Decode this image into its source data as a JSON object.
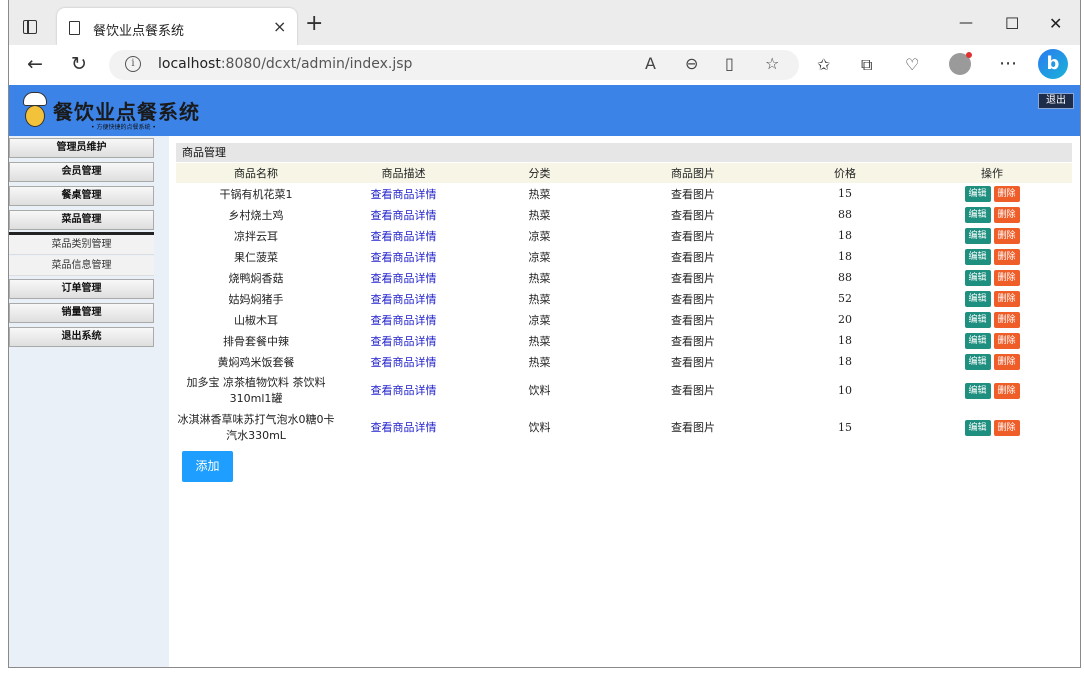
{
  "browser": {
    "tab_title": "餐饮业点餐系统",
    "tab_close": "×",
    "new_tab": "+",
    "minimize": "—",
    "maximize": "☐",
    "close": "✕",
    "url_host": "localhost",
    "url_rest": ":8080/dcxt/admin/index.jsp",
    "info": "i"
  },
  "app": {
    "title": "餐饮业点餐系统",
    "subtitle": "• 方便快捷的点餐系统 •",
    "logout_top": "退出"
  },
  "sidebar": {
    "items": [
      {
        "label": "管理员维护"
      },
      {
        "label": "会员管理"
      },
      {
        "label": "餐桌管理"
      },
      {
        "label": "菜品管理"
      }
    ],
    "subitems": [
      {
        "label": "菜品类别管理"
      },
      {
        "label": "菜品信息管理"
      }
    ],
    "items2": [
      {
        "label": "订单管理"
      },
      {
        "label": "销量管理"
      },
      {
        "label": "退出系统"
      }
    ]
  },
  "main": {
    "section_title": "商品管理",
    "columns": [
      "商品名称",
      "商品描述",
      "分类",
      "商品图片",
      "价格",
      "操作"
    ],
    "rows": [
      {
        "name": "干锅有机花菜1",
        "desc": "查看商品详情",
        "category": "热菜",
        "image": "查看图片",
        "price": "15"
      },
      {
        "name": "乡村烧土鸡",
        "desc": "查看商品详情",
        "category": "热菜",
        "image": "查看图片",
        "price": "88"
      },
      {
        "name": "凉拌云耳",
        "desc": "查看商品详情",
        "category": "凉菜",
        "image": "查看图片",
        "price": "18"
      },
      {
        "name": "果仁菠菜",
        "desc": "查看商品详情",
        "category": "凉菜",
        "image": "查看图片",
        "price": "18"
      },
      {
        "name": "烧鸭焖香菇",
        "desc": "查看商品详情",
        "category": "热菜",
        "image": "查看图片",
        "price": "88"
      },
      {
        "name": "姑妈焖猪手",
        "desc": "查看商品详情",
        "category": "热菜",
        "image": "查看图片",
        "price": "52"
      },
      {
        "name": "山椒木耳",
        "desc": "查看商品详情",
        "category": "凉菜",
        "image": "查看图片",
        "price": "20"
      },
      {
        "name": "排骨套餐中辣",
        "desc": "查看商品详情",
        "category": "热菜",
        "image": "查看图片",
        "price": "18"
      },
      {
        "name": "黄焖鸡米饭套餐",
        "desc": "查看商品详情",
        "category": "热菜",
        "image": "查看图片",
        "price": "18"
      },
      {
        "name": "加多宝 凉茶植物饮料 茶饮料 310ml1罐",
        "desc": "查看商品详情",
        "category": "饮料",
        "image": "查看图片",
        "price": "10"
      },
      {
        "name": "冰淇淋香草味苏打气泡水0糖0卡汽水330mL",
        "desc": "查看商品详情",
        "category": "饮料",
        "image": "查看图片",
        "price": "15"
      }
    ],
    "edit_label": "编辑",
    "delete_label": "删除",
    "add_label": "添加"
  }
}
